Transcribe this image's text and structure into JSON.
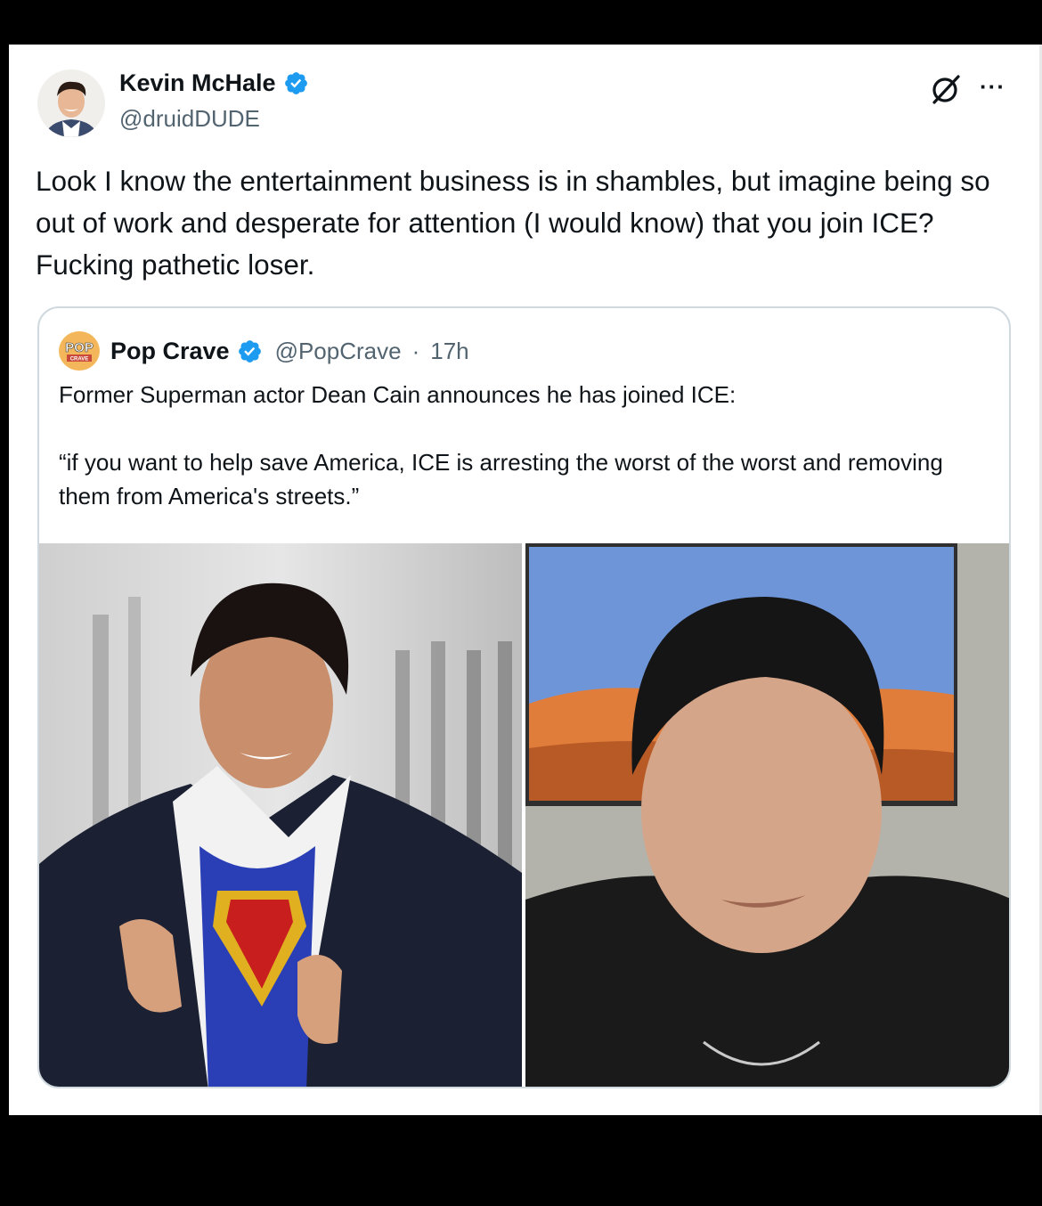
{
  "tweet": {
    "author_name": "Kevin McHale",
    "author_handle": "@druidDUDE",
    "text": "Look I know the entertainment business is in shambles, but imagine being so out of work and desperate for attention (I would know) that you join ICE? Fucking pathetic loser.",
    "more_label": "···"
  },
  "quoted_tweet": {
    "author_name": "Pop Crave",
    "author_handle": "@PopCrave",
    "separator": "·",
    "time": "17h",
    "logo_text_top": "POP",
    "logo_text_bottom": "CRAVE",
    "text_line_1": "Former Superman actor Dean Cain announces he has joined ICE:",
    "text_line_2": "“if you want to help save America, ICE is arresting the worst of the worst and removing them from America's streets.”"
  },
  "colors": {
    "verified_blue": "#1d9bf0",
    "secondary_text": "#536471",
    "border": "#cfd9de"
  },
  "icons": [
    "verified-badge-icon",
    "grok-icon",
    "more-icon"
  ]
}
